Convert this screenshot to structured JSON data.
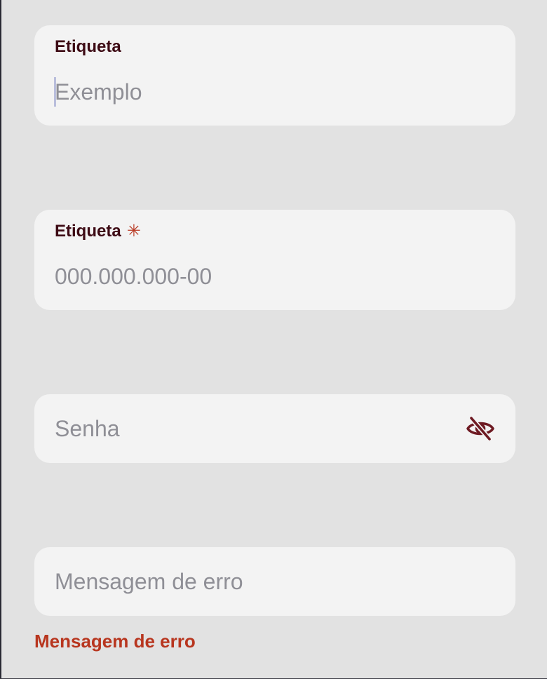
{
  "fields": [
    {
      "label": "Etiqueta",
      "placeholder": "Exemplo",
      "required": false
    },
    {
      "label": "Etiqueta",
      "placeholder": "000.000.000-00",
      "required": true,
      "required_marker": "✳"
    },
    {
      "placeholder": "Senha",
      "toggle_icon": "eye-off-icon"
    },
    {
      "placeholder": "Mensagem de erro",
      "error_message": "Mensagem de erro"
    }
  ],
  "colors": {
    "background": "#e2e2e2",
    "field": "#f3f3f3",
    "label": "#3d0a14",
    "placeholder": "#8f8f96",
    "error": "#b8361f",
    "icon": "#6e1a22"
  }
}
